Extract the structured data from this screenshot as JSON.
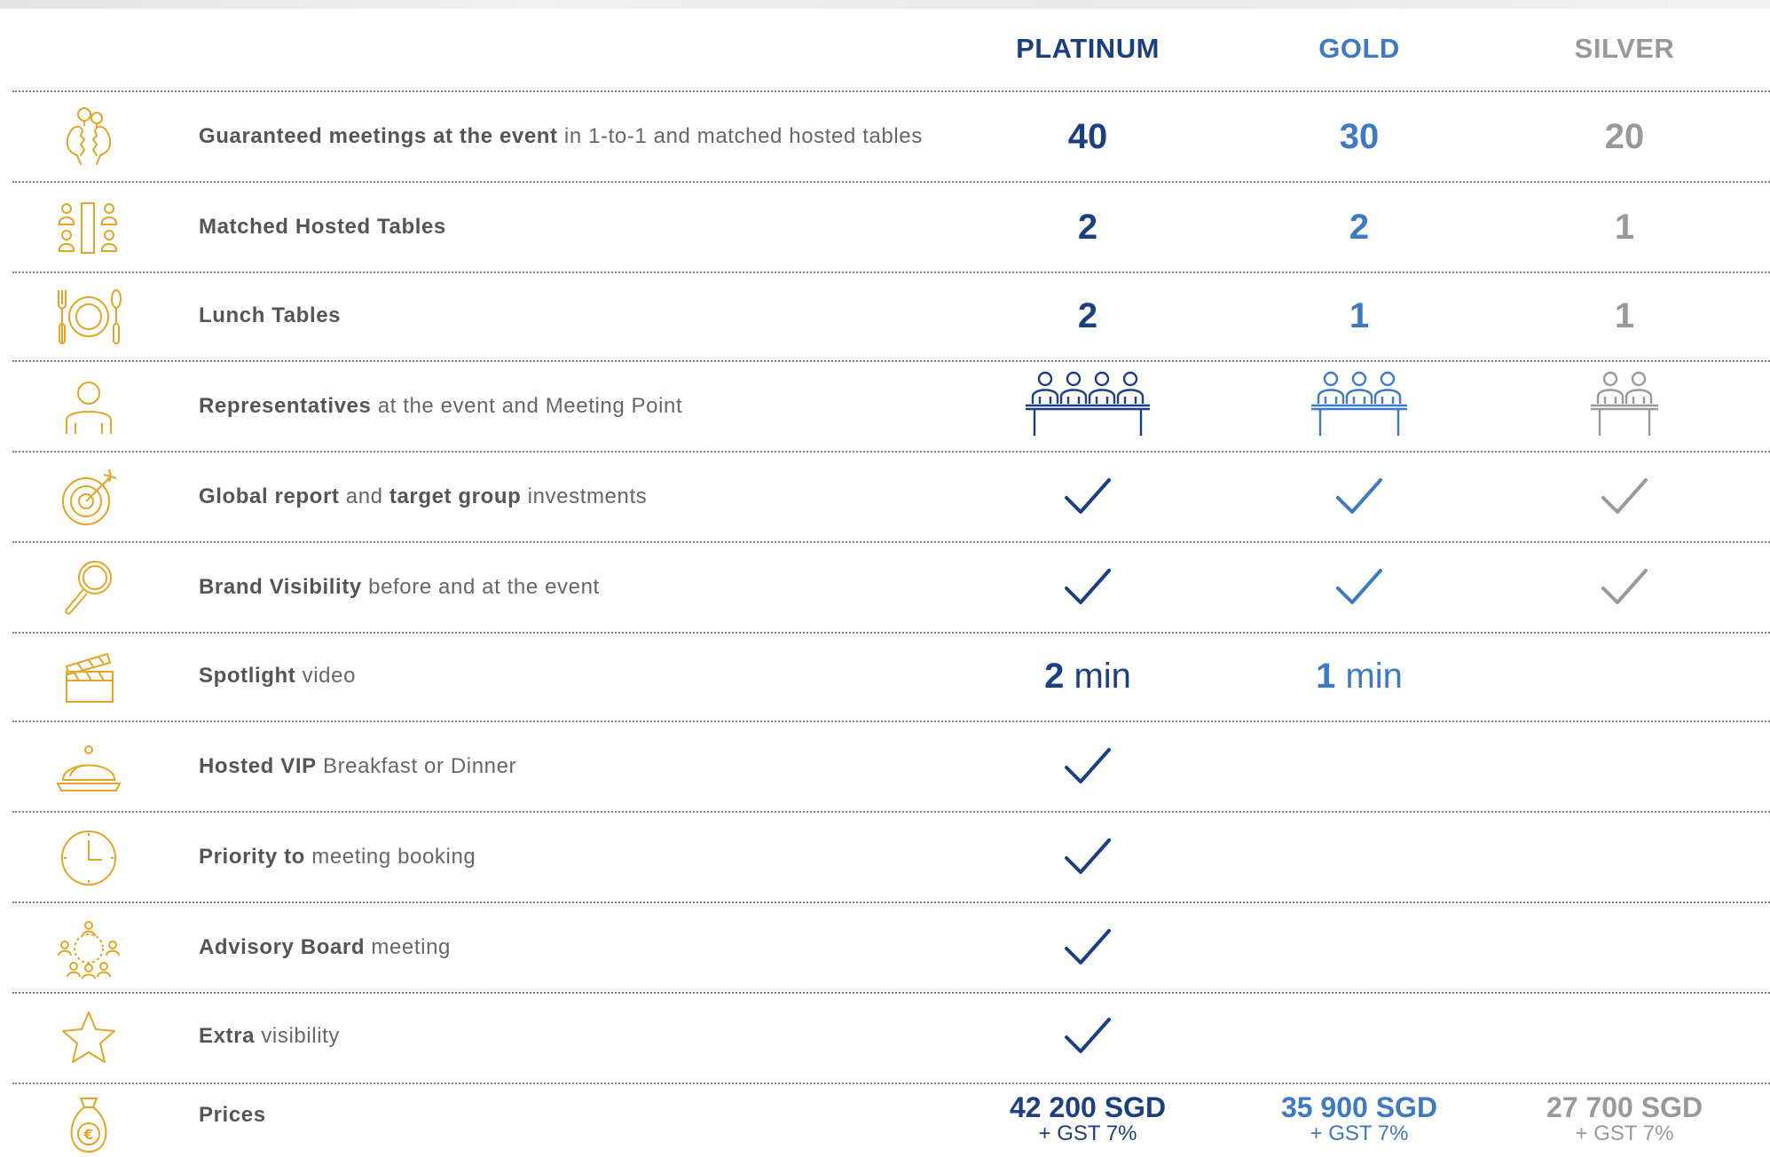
{
  "tiers": {
    "platinum": {
      "name": "PLATINUM",
      "color": "#1c3f7f"
    },
    "gold": {
      "name": "GOLD",
      "color": "#3e7ac1"
    },
    "silver": {
      "name": "SILVER",
      "color": "#999999"
    }
  },
  "icon_color": "#e2a526",
  "rows": [
    {
      "icon": "meeting-heads-icon",
      "bold": "Guaranteed meetings at the event",
      "rest": " in 1-to-1 and matched hosted tables",
      "platinum": "40",
      "gold": "30",
      "silver": "20"
    },
    {
      "icon": "hosted-table-icon",
      "bold": "Matched Hosted Tables",
      "rest": "",
      "platinum": "2",
      "gold": "2",
      "silver": "1"
    },
    {
      "icon": "plate-cutlery-icon",
      "bold": "Lunch Tables",
      "rest": "",
      "platinum": "2",
      "gold": "1",
      "silver": "1"
    },
    {
      "icon": "person-icon",
      "bold": "Representatives",
      "rest": " at the event and Meeting Point",
      "platinum_people": 4,
      "gold_people": 3,
      "silver_people": 2
    },
    {
      "icon": "target-icon",
      "bold": "Global report",
      "mid": " and ",
      "bold2": "target group",
      "rest": " investments",
      "platinum": true,
      "gold": true,
      "silver": true
    },
    {
      "icon": "magnifier-icon",
      "bold": "Brand Visibility",
      "rest": " before and at the event",
      "platinum": true,
      "gold": true,
      "silver": true
    },
    {
      "icon": "clapperboard-icon",
      "bold": "Spotlight",
      "rest": " video",
      "platinum_min": "2",
      "gold_min": "1",
      "unit": " min"
    },
    {
      "icon": "cloche-icon",
      "bold": "Hosted VIP",
      "rest": " Breakfast or Dinner",
      "platinum": true
    },
    {
      "icon": "clock-icon",
      "bold": "Priority to",
      "rest": " meeting booking",
      "platinum": true
    },
    {
      "icon": "people-network-icon",
      "bold": "Advisory Board",
      "rest": " meeting",
      "platinum": true
    },
    {
      "icon": "star-icon",
      "bold": "Extra",
      "rest": " visibility",
      "platinum": true
    },
    {
      "icon": "money-bag-icon",
      "bold": "Prices",
      "rest": "",
      "platinum_price": "42 200 SGD",
      "gold_price": "35 900 SGD",
      "silver_price": "27 700 SGD",
      "tax": "+ GST 7%"
    }
  ]
}
